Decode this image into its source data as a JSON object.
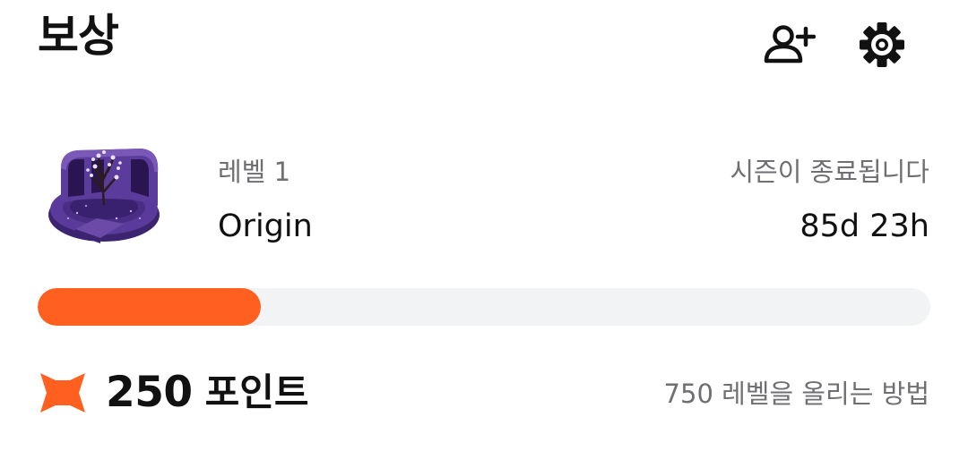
{
  "header": {
    "title": "보상",
    "add_friend_icon": "person-add-icon",
    "settings_icon": "gear-icon"
  },
  "season": {
    "image": "season-origin-emblem",
    "level_label": "레벨 1",
    "level_name": "Origin",
    "ends_label": "시즌이 종료됩니다",
    "remaining": "85d 23h"
  },
  "progress": {
    "fraction": 0.25,
    "color": "#FF5F1F"
  },
  "points": {
    "icon": "fox-icon",
    "value": "250",
    "unit": "포인트",
    "levelup_text": "750 레벨을 올리는 방법",
    "accent": "#FF5F1F"
  }
}
